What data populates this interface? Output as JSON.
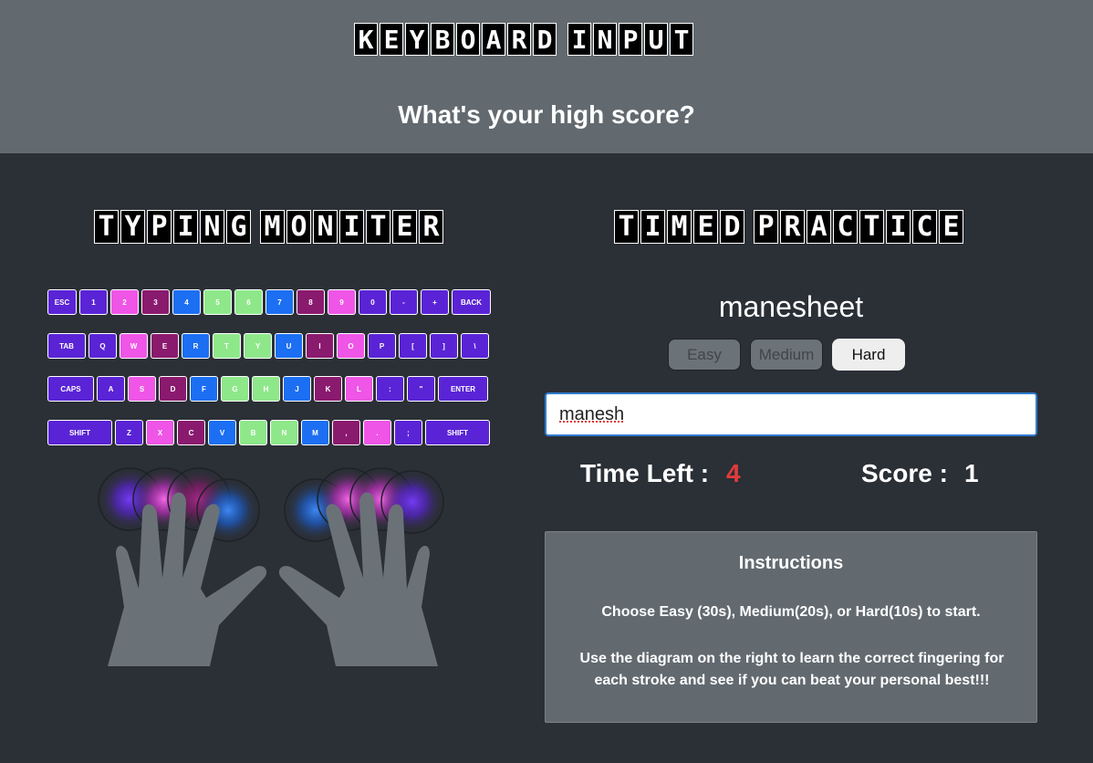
{
  "header": {
    "title_letters": [
      "K",
      "E",
      "Y",
      "B",
      "O",
      "A",
      "R",
      "D",
      " ",
      "I",
      "N",
      "P",
      "U",
      "T"
    ],
    "subtitle": "What's your high score?"
  },
  "typing_monitor": {
    "title_letters": [
      "T",
      "Y",
      "P",
      "I",
      "N",
      "G",
      " ",
      "M",
      "O",
      "N",
      "I",
      "T",
      "E",
      "R"
    ],
    "keyboard_rows": [
      [
        {
          "label": "ESC",
          "color": "indigo",
          "w": 32
        },
        {
          "label": "1",
          "color": "indigo",
          "w": 31
        },
        {
          "label": "2",
          "color": "pink",
          "w": 31
        },
        {
          "label": "3",
          "color": "plum",
          "w": 31
        },
        {
          "label": "4",
          "color": "blue",
          "w": 31
        },
        {
          "label": "5",
          "color": "green",
          "w": 31
        },
        {
          "label": "6",
          "color": "green",
          "w": 31
        },
        {
          "label": "7",
          "color": "blue",
          "w": 31
        },
        {
          "label": "8",
          "color": "plum",
          "w": 31
        },
        {
          "label": "9",
          "color": "pink",
          "w": 31
        },
        {
          "label": "0",
          "color": "indigo",
          "w": 31
        },
        {
          "label": "-",
          "color": "indigo",
          "w": 31
        },
        {
          "label": "+",
          "color": "indigo",
          "w": 31
        },
        {
          "label": "BACK",
          "color": "indigo",
          "w": 43
        }
      ],
      [
        {
          "label": "TAB",
          "color": "indigo",
          "w": 42
        },
        {
          "label": "Q",
          "color": "indigo",
          "w": 31
        },
        {
          "label": "W",
          "color": "pink",
          "w": 31
        },
        {
          "label": "E",
          "color": "plum",
          "w": 31
        },
        {
          "label": "R",
          "color": "blue",
          "w": 31
        },
        {
          "label": "T",
          "color": "green",
          "w": 31
        },
        {
          "label": "Y",
          "color": "green",
          "w": 31
        },
        {
          "label": "U",
          "color": "blue",
          "w": 31
        },
        {
          "label": "I",
          "color": "plum",
          "w": 31
        },
        {
          "label": "O",
          "color": "pink",
          "w": 31
        },
        {
          "label": "P",
          "color": "indigo",
          "w": 31
        },
        {
          "label": "[",
          "color": "indigo",
          "w": 31
        },
        {
          "label": "]",
          "color": "indigo",
          "w": 31
        },
        {
          "label": "\\",
          "color": "indigo",
          "w": 31
        }
      ],
      [
        {
          "label": "CAPS",
          "color": "indigo",
          "w": 51
        },
        {
          "label": "A",
          "color": "indigo",
          "w": 31
        },
        {
          "label": "S",
          "color": "pink",
          "w": 31
        },
        {
          "label": "D",
          "color": "plum",
          "w": 31
        },
        {
          "label": "F",
          "color": "blue",
          "w": 31
        },
        {
          "label": "G",
          "color": "green",
          "w": 31
        },
        {
          "label": "H",
          "color": "green",
          "w": 31
        },
        {
          "label": "J",
          "color": "blue",
          "w": 31
        },
        {
          "label": "K",
          "color": "plum",
          "w": 31
        },
        {
          "label": "L",
          "color": "pink",
          "w": 31
        },
        {
          "label": ":",
          "color": "indigo",
          "w": 31
        },
        {
          "label": "\"",
          "color": "indigo",
          "w": 31
        },
        {
          "label": "ENTER",
          "color": "indigo",
          "w": 55
        }
      ],
      [
        {
          "label": "SHIFT",
          "color": "indigo",
          "w": 71
        },
        {
          "label": "Z",
          "color": "indigo",
          "w": 31
        },
        {
          "label": "X",
          "color": "pink",
          "w": 31
        },
        {
          "label": "C",
          "color": "plum",
          "w": 31
        },
        {
          "label": "V",
          "color": "blue",
          "w": 31
        },
        {
          "label": "B",
          "color": "green",
          "w": 31
        },
        {
          "label": "N",
          "color": "green",
          "w": 31
        },
        {
          "label": "M",
          "color": "blue",
          "w": 31
        },
        {
          "label": ",",
          "color": "plum",
          "w": 31
        },
        {
          "label": ".",
          "color": "pink",
          "w": 31
        },
        {
          "label": ";",
          "color": "indigo",
          "w": 31
        },
        {
          "label": "SHIFT",
          "color": "indigo",
          "w": 71
        }
      ]
    ]
  },
  "timed_practice": {
    "title_letters": [
      "T",
      "I",
      "M",
      "E",
      "D",
      " ",
      "P",
      "R",
      "A",
      "C",
      "T",
      "I",
      "C",
      "E"
    ],
    "word": "manesheet",
    "buttons": {
      "easy": "Easy",
      "medium": "Medium",
      "hard": "Hard"
    },
    "input_value": "manesh",
    "time_left_label": "Time Left :",
    "time_left_value": "4",
    "score_label": "Score :",
    "score_value": "1"
  },
  "instructions": {
    "title": "Instructions",
    "line1": "Choose Easy (30s), Medium(20s), or Hard(10s) to start.",
    "line2": "Use the diagram on the right to learn the correct fingering for each stroke and see if you can beat your personal best!!!"
  },
  "colors": {
    "indigo": "#5a24d6",
    "pink": "#ef55e6",
    "plum": "#8a1a6e",
    "blue": "#1c6ff2",
    "green": "#8ee88a",
    "time_value": "#e23b3b"
  }
}
